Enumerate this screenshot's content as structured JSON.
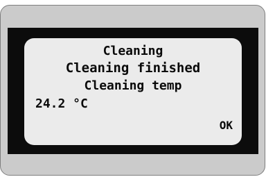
{
  "display": {
    "title": "Cleaning",
    "status": "Cleaning finished",
    "label": "Cleaning temp",
    "temperature": "24.2 °C",
    "ok_label": "OK"
  },
  "colors": {
    "housing": "#cbcbcb",
    "bezel": "#0c0c0c",
    "screen": "#ebebeb",
    "text": "#0a0a0a"
  }
}
